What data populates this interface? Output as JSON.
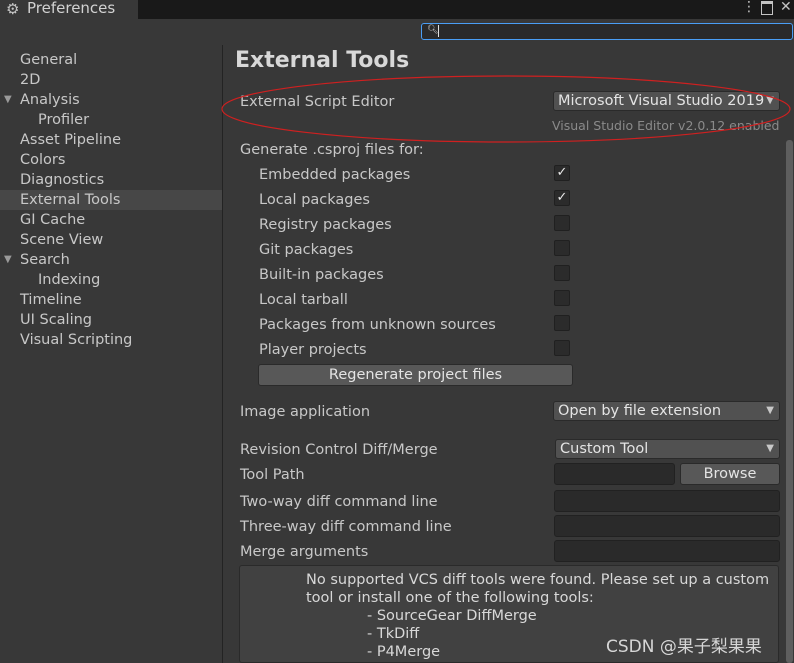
{
  "window": {
    "tab_title": "Preferences",
    "tab_icon": "gear-icon",
    "menu_icon": "kebab-icon",
    "maximize_icon": "maximize-icon",
    "close_icon": "close-icon"
  },
  "search": {
    "value": "",
    "icon": "search-icon"
  },
  "sidebar": {
    "items": [
      {
        "label": "General"
      },
      {
        "label": "2D"
      },
      {
        "label": "Analysis",
        "expanded": true
      },
      {
        "label": "Profiler"
      },
      {
        "label": "Asset Pipeline"
      },
      {
        "label": "Colors"
      },
      {
        "label": "Diagnostics"
      },
      {
        "label": "External Tools",
        "selected": true
      },
      {
        "label": "GI Cache"
      },
      {
        "label": "Scene View"
      },
      {
        "label": "Search",
        "expanded": true
      },
      {
        "label": "Indexing"
      },
      {
        "label": "Timeline"
      },
      {
        "label": "UI Scaling"
      },
      {
        "label": "Visual Scripting"
      }
    ]
  },
  "main": {
    "title": "External Tools",
    "script_editor": {
      "label": "External Script Editor",
      "value": "Microsoft Visual Studio 2019",
      "info": "Visual Studio Editor v2.0.12 enabled"
    },
    "csproj": {
      "heading": "Generate .csproj files for:",
      "options": [
        {
          "label": "Embedded packages",
          "checked": true
        },
        {
          "label": "Local packages",
          "checked": true
        },
        {
          "label": "Registry packages",
          "checked": false
        },
        {
          "label": "Git packages",
          "checked": false
        },
        {
          "label": "Built-in packages",
          "checked": false
        },
        {
          "label": "Local tarball",
          "checked": false
        },
        {
          "label": "Packages from unknown sources",
          "checked": false
        },
        {
          "label": "Player projects",
          "checked": false
        }
      ],
      "regenerate_label": "Regenerate project files"
    },
    "image_app": {
      "label": "Image application",
      "value": "Open by file extension"
    },
    "revision": {
      "label": "Revision Control Diff/Merge",
      "value": "Custom Tool"
    },
    "tool_path": {
      "label": "Tool Path",
      "value": "",
      "browse_label": "Browse"
    },
    "two_way": {
      "label": "Two-way diff command line",
      "value": ""
    },
    "three_way": {
      "label": "Three-way diff command line",
      "value": ""
    },
    "merge_args": {
      "label": "Merge arguments",
      "value": ""
    },
    "help": {
      "line1": "No supported VCS diff tools were found. Please set up a custom",
      "line2": "tool or install one of the following tools:",
      "tools": [
        "- SourceGear DiffMerge",
        "- TkDiff",
        "- P4Merge"
      ]
    }
  },
  "watermark": "CSDN @果子梨果果",
  "colors": {
    "accent_focus": "#4a9ef5",
    "annotation": "#d02020",
    "selected_row": "#474747"
  }
}
